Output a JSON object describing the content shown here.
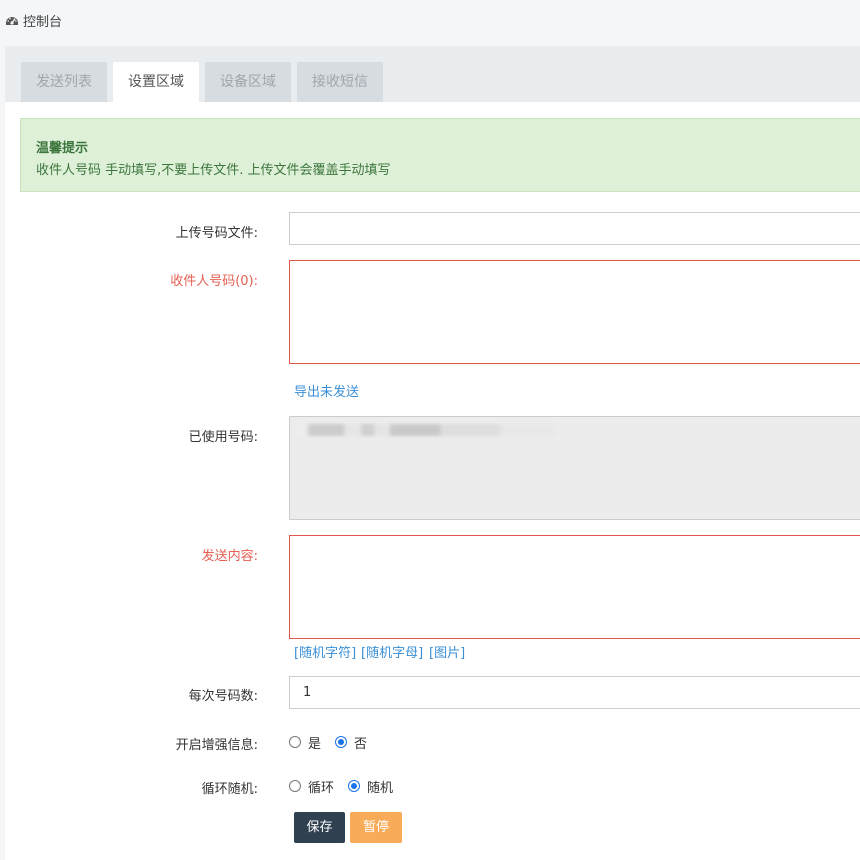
{
  "header": {
    "title": "控制台",
    "icon": "dashboard-icon"
  },
  "tabs": [
    {
      "label": "发送列表",
      "active": false
    },
    {
      "label": "设置区域",
      "active": true
    },
    {
      "label": "设备区域",
      "active": false
    },
    {
      "label": "接收短信",
      "active": false
    }
  ],
  "alert": {
    "title": "温馨提示",
    "text": "收件人号码 手动填写,不要上传文件. 上传文件会覆盖手动填写"
  },
  "form": {
    "upload_label": "上传号码文件:",
    "upload_value": "",
    "recipients_label": "收件人号码(0):",
    "recipients_value": "",
    "export_link": "导出未发送",
    "used_label": "已使用号码:",
    "used_value": "",
    "content_label": "发送内容:",
    "content_value": "",
    "insert_links": [
      "[随机字符]",
      "[随机字母]",
      "[图片]"
    ],
    "per_batch_label": "每次号码数:",
    "per_batch_value": "1",
    "enhanced_label": "开启增强信息:",
    "enhanced_options": [
      {
        "label": "是",
        "checked": false
      },
      {
        "label": "否",
        "checked": true
      }
    ],
    "loop_label": "循环随机:",
    "loop_options": [
      {
        "label": "循环",
        "checked": false
      },
      {
        "label": "随机",
        "checked": true
      }
    ]
  },
  "buttons": {
    "save": "保存",
    "pause": "暂停"
  },
  "colors": {
    "primary": "#2f4050",
    "warning": "#f8ac59",
    "link": "#3a8fd6",
    "error": "#e55f52",
    "alert_bg": "#dff0d8"
  }
}
